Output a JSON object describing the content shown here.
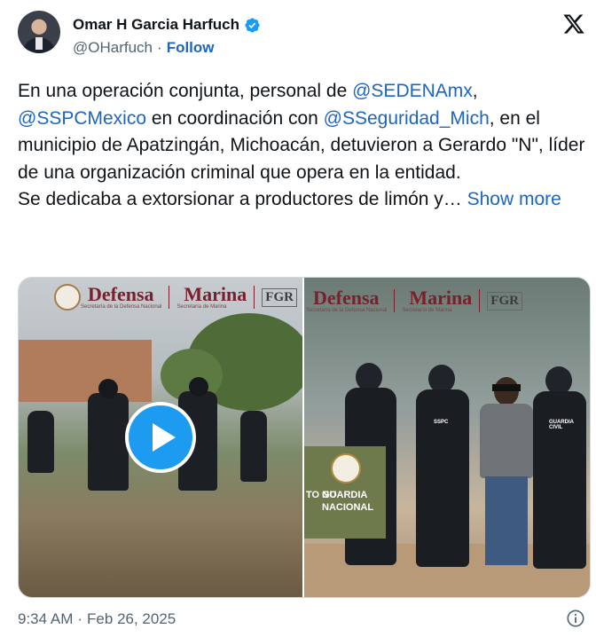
{
  "author": {
    "name": "Omar H Garcia Harfuch",
    "handle": "@OHarfuch",
    "separator": "·",
    "follow_label": "Follow"
  },
  "tweet": {
    "parts": {
      "p1": "En una operación conjunta, personal de ",
      "m1": "@SEDENAmx",
      "p2": ",",
      "m2": "@SSPCMexico",
      "p3": " en coordinación con ",
      "m3": "@SSeguridad_Mich",
      "p4": ", en el municipio de Apatzingán, Michoacán, detuvieron a Gerardo \"N\", líder de una organización criminal que opera en la entidad.",
      "p5": "Se dedicaba a extorsionar a productores de limón y…",
      "show_more": "Show more"
    }
  },
  "media": {
    "logo_defensa": "Defensa",
    "logo_defensa_sub": "Secretaría de la Defensa Nacional",
    "logo_marina": "Marina",
    "logo_marina_sub": "Secretaría de Marina",
    "logo_fgr": "FGR",
    "banner_text": "GUARDIA NACIONAL",
    "banner_left": "TO NO",
    "vest_sspc": "SSPC",
    "vest_guardia": "GUARDIA CIVIL"
  },
  "footer": {
    "time": "9:34 AM",
    "separator": "·",
    "date": "Feb 26, 2025"
  },
  "colors": {
    "link": "#1d65c1",
    "verified": "#1d9bf0",
    "play": "#1d9bf0"
  },
  "icons": {
    "verified": "verified-badge-icon",
    "x_logo": "x-logo-icon",
    "play": "play-icon",
    "info": "info-icon"
  }
}
